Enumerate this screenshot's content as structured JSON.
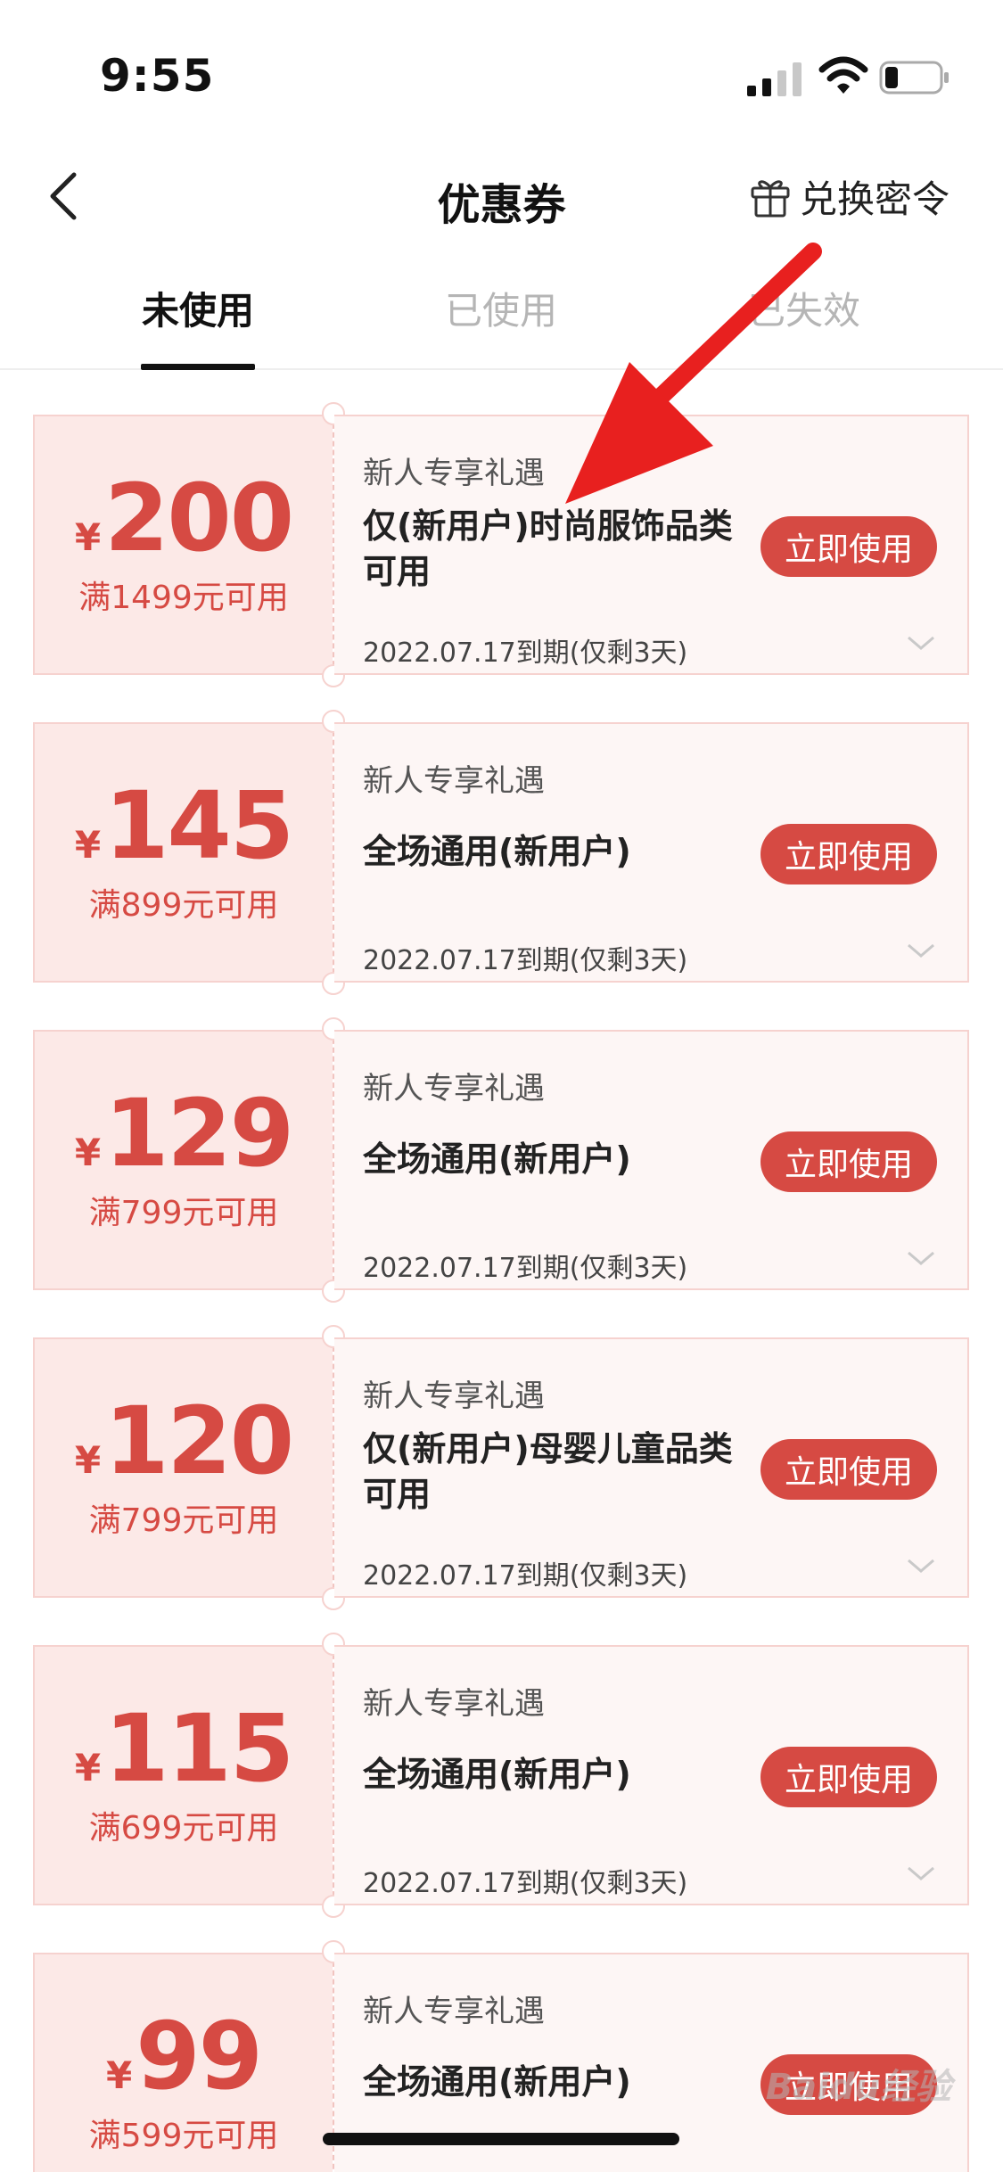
{
  "status_bar": {
    "time": "9:55"
  },
  "nav": {
    "title": "优惠券",
    "redeem_label": "兑换密令"
  },
  "tabs": [
    {
      "label": "未使用",
      "active": true
    },
    {
      "label": "已使用",
      "active": false
    },
    {
      "label": "已失效",
      "active": false
    }
  ],
  "coupons": [
    {
      "currency": "¥",
      "amount": "200",
      "condition": "满1499元可用",
      "tag": "新人专享礼遇",
      "description": "仅(新用户)时尚服饰品类可用",
      "expiry": "2022.07.17到期(仅剩3天)",
      "button": "立即使用"
    },
    {
      "currency": "¥",
      "amount": "145",
      "condition": "满899元可用",
      "tag": "新人专享礼遇",
      "description": "全场通用(新用户)",
      "expiry": "2022.07.17到期(仅剩3天)",
      "button": "立即使用"
    },
    {
      "currency": "¥",
      "amount": "129",
      "condition": "满799元可用",
      "tag": "新人专享礼遇",
      "description": "全场通用(新用户)",
      "expiry": "2022.07.17到期(仅剩3天)",
      "button": "立即使用"
    },
    {
      "currency": "¥",
      "amount": "120",
      "condition": "满799元可用",
      "tag": "新人专享礼遇",
      "description": "仅(新用户)母婴儿童品类可用",
      "expiry": "2022.07.17到期(仅剩3天)",
      "button": "立即使用"
    },
    {
      "currency": "¥",
      "amount": "115",
      "condition": "满699元可用",
      "tag": "新人专享礼遇",
      "description": "全场通用(新用户)",
      "expiry": "2022.07.17到期(仅剩3天)",
      "button": "立即使用"
    },
    {
      "currency": "¥",
      "amount": "99",
      "condition": "满599元可用",
      "tag": "新人专享礼遇",
      "description": "全场通用(新用户)",
      "expiry": "",
      "button": "立即使用"
    }
  ],
  "watermark": "Baidu经验",
  "colors": {
    "accent": "#d64a43",
    "coupon_left_bg": "#fce9e7",
    "annotation_arrow": "#e8201f"
  }
}
